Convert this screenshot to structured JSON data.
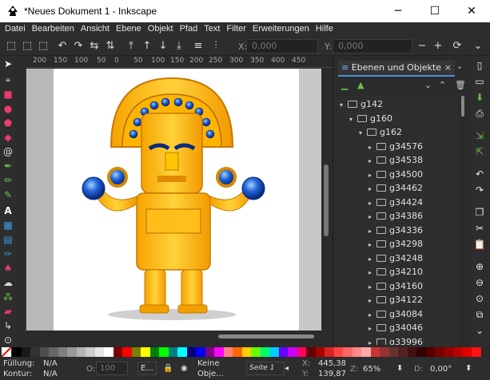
{
  "window": {
    "title": "*Neues Dokument 1 - Inkscape",
    "min": "─",
    "max": "☐",
    "close": "✕"
  },
  "menu": [
    "Datei",
    "Bearbeiten",
    "Ansicht",
    "Ebene",
    "Objekt",
    "Pfad",
    "Text",
    "Filter",
    "Erweiterungen",
    "Hilfe"
  ],
  "controls": {
    "x_label": "X:",
    "x_value": "0,000",
    "y_label": "Y:",
    "y_value": "0,000"
  },
  "ruler": {
    "h_ticks": [
      "200",
      "150",
      "100",
      "50",
      "0",
      "50",
      "100",
      "150",
      "200",
      "250",
      "300",
      "350",
      "400",
      "450"
    ]
  },
  "panel": {
    "tab_label": "Ebenen und Objekte",
    "tab_close": "×",
    "tree": [
      {
        "label": "g142",
        "depth": 0,
        "expanded": true
      },
      {
        "label": "g160",
        "depth": 1,
        "expanded": true
      },
      {
        "label": "g162",
        "depth": 2,
        "expanded": true
      },
      {
        "label": "g34576",
        "depth": 3,
        "expanded": false
      },
      {
        "label": "g34538",
        "depth": 3,
        "expanded": false
      },
      {
        "label": "g34500",
        "depth": 3,
        "expanded": false
      },
      {
        "label": "g34462",
        "depth": 3,
        "expanded": false
      },
      {
        "label": "g34424",
        "depth": 3,
        "expanded": false
      },
      {
        "label": "g34386",
        "depth": 3,
        "expanded": false
      },
      {
        "label": "g34336",
        "depth": 3,
        "expanded": false
      },
      {
        "label": "g34298",
        "depth": 3,
        "expanded": false
      },
      {
        "label": "g34248",
        "depth": 3,
        "expanded": false
      },
      {
        "label": "g34210",
        "depth": 3,
        "expanded": false
      },
      {
        "label": "g34160",
        "depth": 3,
        "expanded": false
      },
      {
        "label": "g34122",
        "depth": 3,
        "expanded": false
      },
      {
        "label": "g34084",
        "depth": 3,
        "expanded": false
      },
      {
        "label": "g34046",
        "depth": 3,
        "expanded": false
      },
      {
        "label": "g33996",
        "depth": 3,
        "expanded": false
      }
    ]
  },
  "palette": [
    "#000000",
    "#1a1a1a",
    "#333333",
    "#4d4d4d",
    "#666666",
    "#808080",
    "#999999",
    "#b3b3b3",
    "#cccccc",
    "#e6e6e6",
    "#ffffff",
    "#800000",
    "#ff0000",
    "#808000",
    "#ffff00",
    "#008000",
    "#00ff00",
    "#008080",
    "#00ffff",
    "#000080",
    "#0000ff",
    "#800080",
    "#ff00ff",
    "#ff8080",
    "#ff6600",
    "#ffcc00",
    "#66ff00",
    "#00ff66",
    "#00ccff",
    "#6600ff",
    "#cc00ff",
    "#ff0066",
    "#660000",
    "#aa0000",
    "#dd2222",
    "#ff4444",
    "#ff6666",
    "#ff8888",
    "#ffaaaa",
    "#cc3333",
    "#993333",
    "#663333",
    "#552222",
    "#441111",
    "#330000",
    "#550000",
    "#770000",
    "#990000",
    "#bb0000",
    "#dd0000",
    "#ff1111"
  ],
  "status": {
    "fill_label": "Füllung:",
    "fill_value": "N/A",
    "stroke_label": "Kontur:",
    "stroke_value": "N/A",
    "opacity_label": "O:",
    "opacity_value": "100",
    "layer": "E...",
    "no_objects_line1": "Keine",
    "no_objects_line2": "Obje...",
    "page": "Seite 1",
    "x_label": "X:",
    "x_value": "445,38",
    "y_label": "Y:",
    "y_value": "139,87",
    "zoom_label": "Z:",
    "zoom_value": "65%",
    "rotation_label": "D:",
    "rotation_value": "0,00°"
  }
}
